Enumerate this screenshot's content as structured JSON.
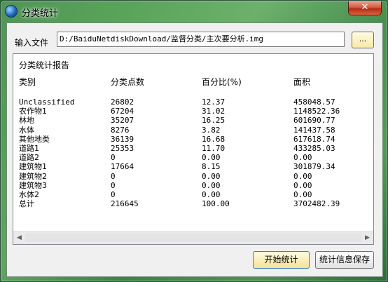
{
  "window": {
    "title": "分类统计",
    "close_label": "✕"
  },
  "file": {
    "label": "输入文件",
    "path": "D:/BaiduNetdiskDownload/监督分类/主次要分析.img",
    "browse_label": "..."
  },
  "report": {
    "heading": "分类统计报告",
    "columns": [
      "类别",
      "分类点数",
      "百分比(%)",
      "面积"
    ],
    "rows": [
      [
        "Unclassified",
        "26802",
        "12.37",
        "458048.57"
      ],
      [
        "农作物1",
        "67204",
        "31.02",
        "1148522.36"
      ],
      [
        "林地",
        "35207",
        "16.25",
        "601690.77"
      ],
      [
        "水体",
        "8276",
        "3.82",
        "141437.58"
      ],
      [
        "其他地类",
        "36139",
        "16.68",
        "617618.74"
      ],
      [
        "道路1",
        "25353",
        "11.70",
        "433285.03"
      ],
      [
        "道路2",
        "0",
        "0.00",
        "0.00"
      ],
      [
        "建筑物1",
        "17664",
        "8.15",
        "301879.34"
      ],
      [
        "建筑物2",
        "0",
        "0.00",
        "0.00"
      ],
      [
        "建筑物3",
        "0",
        "0.00",
        "0.00"
      ],
      [
        "水体2",
        "0",
        "0.00",
        "0.00"
      ],
      [
        "总计",
        "216645",
        "100.00",
        "3702482.39"
      ]
    ]
  },
  "scroll": {
    "left_arrow": "◀",
    "right_arrow": "▶"
  },
  "buttons": {
    "start": "开始统计",
    "save": "统计信息保存"
  }
}
